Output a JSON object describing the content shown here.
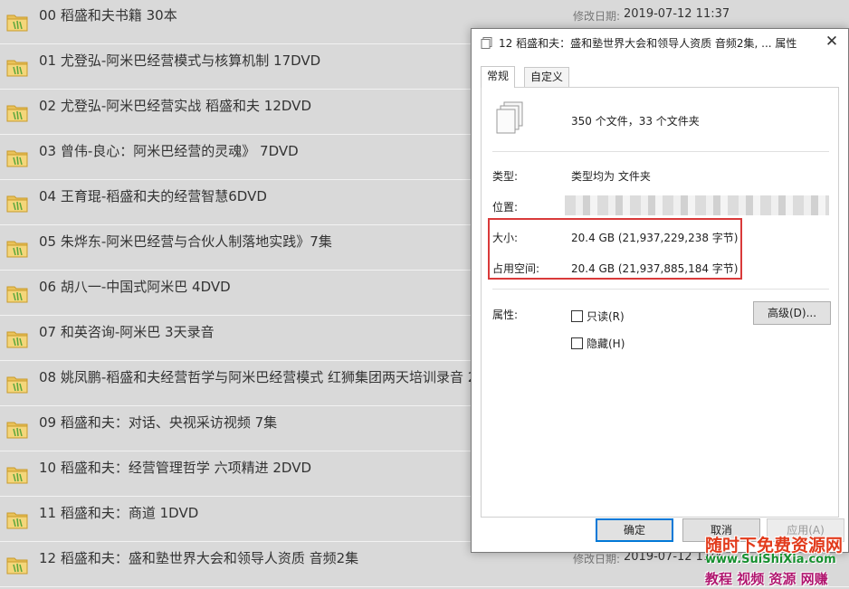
{
  "file_list": {
    "rows": [
      {
        "name": "00 稻盛和夫书籍  30本",
        "date_label": "修改日期:",
        "date": "2019-07-12 11:37"
      },
      {
        "name": "01 尤登弘-阿米巴经营模式与核算机制 17DVD",
        "date_label": "",
        "date": ""
      },
      {
        "name": "02 尤登弘-阿米巴经营实战 稻盛和夫 12DVD",
        "date_label": "",
        "date": ""
      },
      {
        "name": "03 曾伟-良心：阿米巴经营的灵魂》 7DVD",
        "date_label": "",
        "date": ""
      },
      {
        "name": "04 王育琨-稻盛和夫的经营智慧6DVD",
        "date_label": "",
        "date": ""
      },
      {
        "name": "05 朱烨东-阿米巴经营与合伙人制落地实践》7集",
        "date_label": "",
        "date": ""
      },
      {
        "name": "06 胡八一-中国式阿米巴 4DVD",
        "date_label": "",
        "date": ""
      },
      {
        "name": "07 和英咨询-阿米巴 3天录音",
        "date_label": "",
        "date": ""
      },
      {
        "name": "08 姚凤鹏-稻盛和夫经营哲学与阿米巴经营模式 红狮集团两天培训录音 2",
        "date_label": "",
        "date": ""
      },
      {
        "name": "09 稻盛和夫：对话、央视采访视频 7集",
        "date_label": "",
        "date": ""
      },
      {
        "name": "10 稻盛和夫：经营管理哲学 六项精进 2DVD",
        "date_label": "",
        "date": ""
      },
      {
        "name": "11 稻盛和夫：商道 1DVD",
        "date_label": "",
        "date": ""
      },
      {
        "name": "12 稻盛和夫：盛和塾世界大会和领导人资质 音频2集",
        "date_label": "修改日期:",
        "date": "2019-07-12 11:4"
      }
    ]
  },
  "dialog": {
    "title": "12 稻盛和夫：盛和塾世界大会和领导人资质 音频2集, ... 属性",
    "close_glyph": "✕",
    "tabs": [
      {
        "label": "常规",
        "active": true
      },
      {
        "label": "自定义",
        "active": false
      }
    ],
    "summary": "350 个文件，33 个文件夹",
    "type_label": "类型:",
    "type_value": "类型均为 文件夹",
    "location_label": "位置:",
    "size_label": "大小:",
    "size_value": "20.4 GB (21,937,229,238 字节)",
    "disk_label": "占用空间:",
    "disk_value": "20.4 GB (21,937,885,184 字节)",
    "attributes_label": "属性:",
    "readonly_label": "只读(R)",
    "hidden_label": "隐藏(H)",
    "advanced_label": "高级(D)...",
    "ok_label": "确定",
    "cancel_label": "取消",
    "apply_label": "应用(A)"
  },
  "watermark": {
    "line1": "随时下免费资源网",
    "line2": "www.SuiShiXia.com",
    "line3": "教程 视频 资源 网赚"
  },
  "colors": {
    "highlight_border": "#d93a3a",
    "primary_button_border": "#0078d7",
    "folder_yellow": "#f4d67a"
  }
}
